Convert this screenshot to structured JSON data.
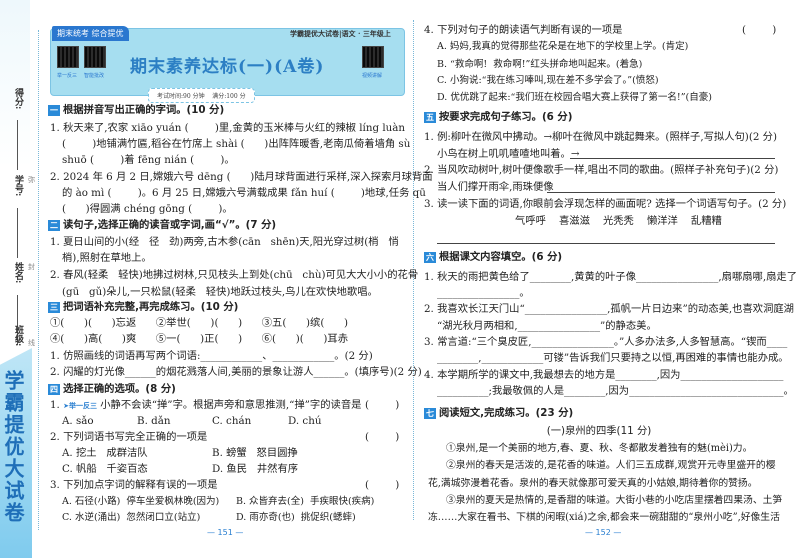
{
  "sidebar": {
    "score": "得分:",
    "student_no": "学号:",
    "name": "姓名:",
    "class": "班级:",
    "brand": "学霸提优大试卷",
    "cut": [
      "弥",
      "封",
      "线"
    ]
  },
  "header": {
    "tag": "期末统考  综合提优",
    "series": "学霸提优大试卷|语文 · 三年级上",
    "qr1": "举一反三",
    "qr2": "智能批改",
    "qr3": "视频讲解",
    "title": "期末素养达标(一)(A卷)",
    "time": "考试时间:90 分钟",
    "score": "满分:100 分"
  },
  "left": {
    "s1": {
      "n": "一",
      "t": "根据拼音写出正确的字词。(10 分)"
    },
    "l1": "1. 秋天来了,农家 xiāo yuán (        )里,金黄的玉米棒与火红的辣椒 líng luàn",
    "l2": "(        )地铺满竹匾,稻谷在竹席上 shài (      )出阵阵暖香,老南瓜倚着墙角 sù",
    "l3": "shuō (        )着 fēng nián (        )。",
    "l4": "2. 2024 年 6 月 2 日,嫦娥六号 dēng (      )陆月球背面进行采样,深入探索月球背面",
    "l5": "的 ào mì (        )。6 月 25 日,嫦娥六号满载成果 fǎn huí (        )地球,任务 qū",
    "l6": "(      )得圆满 chéng gōng (        )。",
    "s2": {
      "n": "二",
      "t": "读句子,选择正确的读音或字词,画“√”。(7 分)"
    },
    "l7": "1. 夏日山间的小(经   径   劲)两旁,古木参(cān   shēn)天,阳光穿过树(梢   悄",
    "l8": "梢),照射在草地上。",
    "l9": "2. 春风(轻柔   轻快)地拂过树林,只见枝头上到处(chū   chù)可见大大小小的花骨",
    "l10": "(gū   gǔ)朵儿,一只松鼠(轻柔   轻快)地跃过枝头,鸟儿在欢快地歌唱。",
    "s3": {
      "n": "三",
      "t": "把词语补充完整,再完成练习。(10 分)"
    },
    "l11": "①(      )(      )忘返      ②举世(      )(      )      ③五(      )缤(      )",
    "l12": "④(      )高(      )爽      ⑤一(      )正(      )      ⑥(      )(      )耳赤",
    "l13": "1. 仿照画线的词语再写两个词语:____________、____________。(2 分)",
    "l14": "2. 闪耀的灯光像______的烟花溅落人间,美丽的景象让游人______。(填序号)(2 分)",
    "s4": {
      "n": "四",
      "t": "选择正确的选项。(8 分)"
    },
    "q1_tag": "➤举一反三",
    "q1": " 小静不会读“掸”字。根据声旁和意思推测,“掸”字的读音是",
    "q1_opts": [
      "A. sǎo",
      "B. dǎn",
      "C. chán",
      "D. chú"
    ],
    "q2": "2. 下列词语书写完全正确的一项是",
    "q2_opts": [
      "A. 挖土   成群洁队",
      "B. 螃蟹   怒目圆挣",
      "C. 帆船   千姿百态",
      "D. 鱼民   井然有序"
    ],
    "q3": "3. 下列加点字词的解释有误的一项是",
    "q3_opts": [
      "A. 石径(小路)  停车坐爱枫林晚(因为)",
      "B. 众皆弃去(全)  手疾眼快(疾病)",
      "C. 水逆(涌出)  忽然闭口立(站立)",
      "D. 雨亦奇(也)  挑促织(蟋蟀)"
    ],
    "paren": "(        )",
    "page": "— 151 —"
  },
  "right": {
    "q4": "4. 下列对句子的朗读语气判断有误的一项是",
    "q4_opts": [
      "A. 妈妈,我真的觉得那些花朵是在地下的学校里上学。(肯定)",
      "B. “救命啊!  救命啊!”红头拼命地叫起来。(着急)",
      "C. 小狗说:“我在练习唪叫,现在差不多学会了。”(愤怒)",
      "D. 优优跳了起来:“我们班在校园合唱大赛上获得了第一名!”(自豪)"
    ],
    "s5": {
      "n": "五",
      "t": "按要求完成句子练习。(6 分)"
    },
    "r1": "1. 例:柳叶在微风中拂动。→柳叶在微风中跳起舞来。(照样子,写拟人句)(2 分)",
    "r2": "小鸟在树上叽叽喳喳地叫着。→",
    "r3": "2. 当风吹动树叶,树叶便像歌手一样,唱出不同的歌曲。(照样子补充句子)(2 分)",
    "r4": "当人们撑开雨伞,雨珠便像",
    "r5": "3. 读一读下面的词语,你眼前会浮现怎样的画面呢? 选择一个词语写句子。(2 分)",
    "r6": "气呼呼    喜滋滋    光秃秃    懒洋洋    乱糟糟",
    "s6": {
      "n": "六",
      "t": "根据课文内容填空。(6 分)"
    },
    "r7": "1. 秋天的雨把黄色给了________,黄黄的叶子像________________,扇哪扇哪,扇走了",
    "r8": "________________。",
    "r9": "2. 我喜欢长江天门山“________________,孤帆一片日边来”的动态美,也喜欢洞庭湖",
    "r10": "“湖光秋月两相和,________________”的静态美。",
    "r11": "3. 常言道:“三个臭皮匠,________________。”人多办法多,人多智慧高。“锲而____",
    "r12": "________,____________可镂”告诉我们只要持之以恒,再困难的事情也能办成。",
    "r13": "4. 本学期所学的课文中,我最想去的地方是________,因为____________________",
    "r14": "__________;我最敬佩的人是________,因为______________________________。",
    "s7": {
      "n": "七",
      "t": "阅读短文,完成练习。(23 分)"
    },
    "r15": "(一)泉州的四季(11 分)",
    "r16": "①泉州,是一个美丽的地方,春、夏、秋、冬都散发着独有的魅(mèi)力。",
    "r17": "②泉州的春天是活泼的,是花香的味道。人们三五成群,观赏开元寺里盛开的樱",
    "r18": "花,满城弥漫着花香。泉州的春天就像那可爱天真的小姑娘,期待着你的赞扬。",
    "r19": "③泉州的夏天是热情的,是香甜的味道。大街小巷的小吃店里摆着四果汤、土笋",
    "r20": "冻……大家在看书、下棋的闲暇(xiá)之余,都会来一碗甜甜的“泉州小吃”,好像生活",
    "paren": "(        )",
    "page": "— 152 —"
  }
}
